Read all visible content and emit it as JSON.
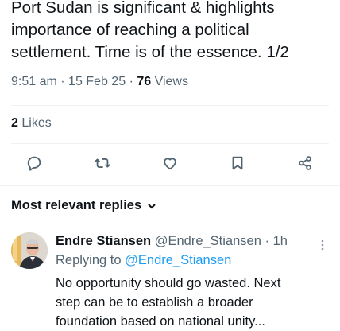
{
  "tweet": {
    "text_lines": [
      "Port Sudan is significant & highlights",
      "importance of reaching a political",
      "settlement. Time is of the essence. 1/2"
    ],
    "time": "9:51 am",
    "date": "15 Feb 25",
    "views_count": "76",
    "views_label": "Views",
    "likes_count": "2",
    "likes_label": "Likes"
  },
  "actions": {
    "icons": [
      "reply-icon",
      "retweet-icon",
      "like-icon",
      "bookmark-icon",
      "share-icon"
    ]
  },
  "replies": {
    "sort_label": "Most relevant replies"
  },
  "reply": {
    "author_name": "Endre Stiansen",
    "author_handle": "@Endre_Stiansen",
    "age": "1h",
    "replying_prefix": "Replying to",
    "replying_to": "@Endre_Stiansen",
    "text_lines": [
      "No opportunity should go wasted. Next",
      "step can be to establish a broader",
      "foundation based on national unity..."
    ]
  },
  "colors": {
    "text": "#0f1419",
    "secondary": "#536471",
    "link": "#1d9bf0",
    "divider": "#eff3f4"
  }
}
